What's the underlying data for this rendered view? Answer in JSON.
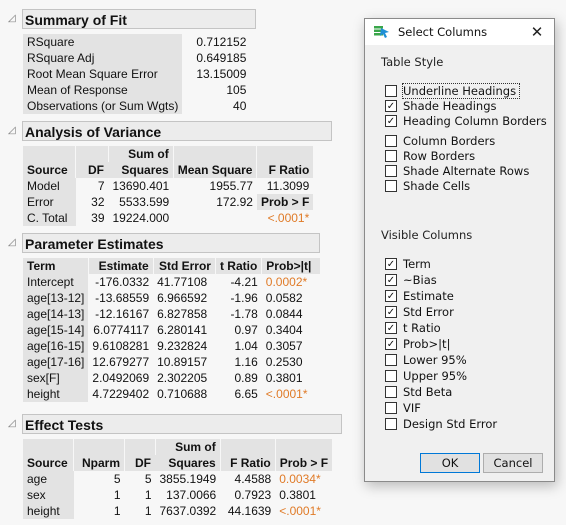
{
  "summary_of_fit": {
    "title": "Summary of Fit",
    "rows": [
      {
        "label": "RSquare",
        "value": "0.712152"
      },
      {
        "label": "RSquare Adj",
        "value": "0.649185"
      },
      {
        "label": "Root Mean Square Error",
        "value": "13.15009"
      },
      {
        "label": "Mean of Response",
        "value": "105"
      },
      {
        "label": "Observations (or Sum Wgts)",
        "value": "40"
      }
    ]
  },
  "anova": {
    "title": "Analysis of Variance",
    "headers": {
      "source": "Source",
      "df": "DF",
      "ss_top": "Sum of",
      "ss_bottom": "Squares",
      "ms": "Mean Square",
      "f": "F Ratio"
    },
    "rows": [
      {
        "source": "Model",
        "df": "7",
        "ss": "13690.401",
        "ms": "1955.77",
        "f": "11.3099"
      },
      {
        "source": "Error",
        "df": "32",
        "ss": "5533.599",
        "ms": "172.92",
        "f": "Prob > F"
      },
      {
        "source": "C. Total",
        "df": "39",
        "ss": "19224.000",
        "ms": "",
        "f": "<.0001*"
      }
    ]
  },
  "parameter_estimates": {
    "title": "Parameter Estimates",
    "headers": {
      "term": "Term",
      "estimate": "Estimate",
      "std_error": "Std Error",
      "t_ratio": "t Ratio",
      "prob": "Prob>|t|"
    },
    "rows": [
      {
        "term": "Intercept",
        "estimate": "-176.0332",
        "std_error": "41.77108",
        "t_ratio": "-4.21",
        "prob": "0.0002*",
        "significant": true
      },
      {
        "term": "age[13-12]",
        "estimate": "-13.68559",
        "std_error": "6.966592",
        "t_ratio": "-1.96",
        "prob": "0.0582",
        "significant": false
      },
      {
        "term": "age[14-13]",
        "estimate": "-12.16167",
        "std_error": "6.827858",
        "t_ratio": "-1.78",
        "prob": "0.0844",
        "significant": false
      },
      {
        "term": "age[15-14]",
        "estimate": "6.0774117",
        "std_error": "6.280141",
        "t_ratio": "0.97",
        "prob": "0.3404",
        "significant": false
      },
      {
        "term": "age[16-15]",
        "estimate": "9.6108281",
        "std_error": "9.232824",
        "t_ratio": "1.04",
        "prob": "0.3057",
        "significant": false
      },
      {
        "term": "age[17-16]",
        "estimate": "12.679277",
        "std_error": "10.89157",
        "t_ratio": "1.16",
        "prob": "0.2530",
        "significant": false
      },
      {
        "term": "sex[F]",
        "estimate": "2.0492069",
        "std_error": "2.302205",
        "t_ratio": "0.89",
        "prob": "0.3801",
        "significant": false
      },
      {
        "term": "height",
        "estimate": "4.7229402",
        "std_error": "0.710688",
        "t_ratio": "6.65",
        "prob": "<.0001*",
        "significant": true
      }
    ]
  },
  "effect_tests": {
    "title": "Effect Tests",
    "headers": {
      "source": "Source",
      "nparm": "Nparm",
      "df": "DF",
      "ss_top": "Sum of",
      "ss_bottom": "Squares",
      "f": "F Ratio",
      "prob": "Prob > F"
    },
    "rows": [
      {
        "source": "age",
        "nparm": "5",
        "df": "5",
        "ss": "3855.1949",
        "f": "4.4588",
        "prob": "0.0034*",
        "significant": true
      },
      {
        "source": "sex",
        "nparm": "1",
        "df": "1",
        "ss": "137.0066",
        "f": "0.7923",
        "prob": "0.3801",
        "significant": false
      },
      {
        "source": "height",
        "nparm": "1",
        "df": "1",
        "ss": "7637.0392",
        "f": "44.1639",
        "prob": "<.0001*",
        "significant": true
      }
    ]
  },
  "dialog": {
    "title": "Select Columns",
    "close_icon": "close-icon",
    "table_style_label": "Table Style",
    "table_style": [
      {
        "label": "Underline Headings",
        "checked": false,
        "focused": true
      },
      {
        "label": "Shade Headings",
        "checked": true
      },
      {
        "label": "Heading Column Borders",
        "checked": true
      },
      {
        "label": "Column Borders",
        "checked": false
      },
      {
        "label": "Row Borders",
        "checked": false
      },
      {
        "label": "Shade Alternate Rows",
        "checked": false
      },
      {
        "label": "Shade Cells",
        "checked": false
      }
    ],
    "visible_columns_label": "Visible Columns",
    "visible_columns": [
      {
        "label": "Term",
        "checked": true
      },
      {
        "label": "~Bias",
        "checked": true
      },
      {
        "label": "Estimate",
        "checked": true
      },
      {
        "label": "Std Error",
        "checked": true
      },
      {
        "label": "t Ratio",
        "checked": true
      },
      {
        "label": "Prob>|t|",
        "checked": true
      },
      {
        "label": "Lower 95%",
        "checked": false
      },
      {
        "label": "Upper 95%",
        "checked": false
      },
      {
        "label": "Std Beta",
        "checked": false
      },
      {
        "label": "VIF",
        "checked": false
      },
      {
        "label": "Design Std Error",
        "checked": false
      }
    ],
    "ok_label": "OK",
    "cancel_label": "Cancel"
  },
  "colors": {
    "significant": "#e07b28",
    "heading_shade": "#e3e3e3",
    "ok_focus": "#0078d7"
  }
}
